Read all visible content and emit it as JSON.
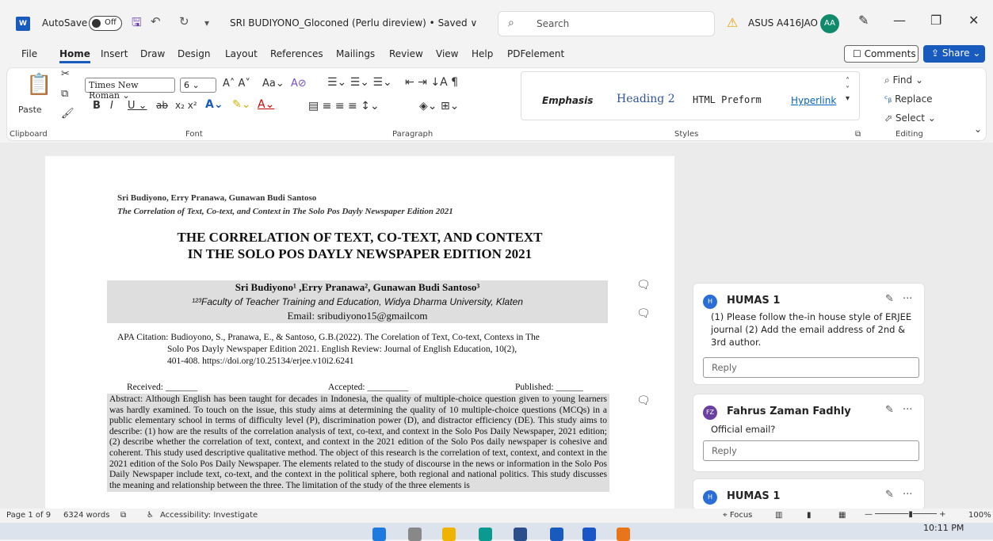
{
  "titlebar": {
    "app_icon": "W",
    "autosave_label": "AutoSave",
    "autosave_state": "Off",
    "doc_title": "SRI BUDIYONO_Gloconed (Perlu direview) • Saved ∨",
    "search_placeholder": "Search",
    "device": "ASUS A416JAO",
    "user_initials": "AA"
  },
  "menu": {
    "items": [
      "File",
      "Home",
      "Insert",
      "Draw",
      "Design",
      "Layout",
      "References",
      "Mailings",
      "Review",
      "View",
      "Help",
      "PDFelement"
    ],
    "comments_label": "Comments",
    "share_label": "Share"
  },
  "ribbon": {
    "paste_label": "Paste",
    "font_name": "Times New Roman",
    "font_size": "6",
    "groups": {
      "clipboard": "Clipboard",
      "font": "Font",
      "paragraph": "Paragraph",
      "styles": "Styles",
      "editing": "Editing"
    },
    "styles": [
      "Emphasis",
      "Heading 2",
      "HTML Preform",
      "Hyperlink"
    ],
    "editing": {
      "find": "Find",
      "replace": "Replace",
      "select": "Select"
    }
  },
  "document": {
    "header_authors": "Sri Budiyono, Erry Pranawa, Gunawan Budi Santoso",
    "header_title": "The Correlation of Text, Co-text, and Context in The Solo Pos Dayly Newspaper Edition 2021",
    "title_line1": "THE CORRELATION OF TEXT, CO-TEXT, AND CONTEXT",
    "title_line2": "IN THE SOLO POS DAYLY NEWSPAPER EDITION 2021",
    "authors": "Sri Budiyono¹ ,Erry Pranawa², Gunawan Budi Santoso³",
    "affiliation": "¹²³Faculty of Teacher Training and Education, Widya Dharma University, Klaten",
    "email": "Email: sribudiyono15@gmailcom",
    "apa_line1": "APA Citation: Budioyono, S., Pranawa, E., & Santoso, G.B.(2022). The Corelation of Text, Co-text, Contexs in The",
    "apa_line2": "Solo Pos Dayly Newspaper Edition 2021. English Review: Journal of English Education, 10(2),",
    "apa_line3": "401-408. https://doi.org/10.25134/erjee.v10i2.6241",
    "received": "Received: _______",
    "accepted": "Accepted: _________",
    "published": "Published: ______",
    "abstract": "Abstract: Although English has been taught for decades in Indonesia, the quality of multiple-choice question given to young learners was hardly examined. To touch on the issue, this study aims at determining the quality of 10 multiple-choice questions (MCQs) in a public elementary school in terms of difficulty level (P), discrimination power (D), and distractor efficiency (DE). This study aims to describe: (1) how are the results of the correlation analysis of text, co-text, and context in the Solo Pos Daily Newspaper, 2021 edition; (2) describe whether the correlation of text, context, and context in the 2021 edition of the Solo Pos daily newspaper is cohesive and coherent. This study used descriptive qualitative method. The object of this research is the correlation of text, context, and context in the 2021 edition of the Solo Pos Daily Newspaper. The elements related to the study of discourse in the news or information in the Solo Pos Daily Newspaper include text, co-text, and the context in the political sphere, both regional and national politics. This study discusses the meaning and relationship between the three. The limitation of the study of the three elements is"
  },
  "comments": [
    {
      "initials": "H",
      "author": "HUMAS 1",
      "text": "(1) Please follow the-in house style of ERJEE journal (2) Add the email address of 2nd & 3rd author.",
      "reply": "Reply",
      "color": "#2b6fd6"
    },
    {
      "initials": "FZ",
      "author": "Fahrus Zaman Fadhly",
      "text": "Official email?",
      "reply": "Reply",
      "color": "#6b3fa0"
    },
    {
      "initials": "H",
      "author": "HUMAS 1",
      "text": "",
      "reply": "",
      "color": "#2b6fd6"
    }
  ],
  "status": {
    "page": "Page 1 of 9",
    "words": "6324 words",
    "accessibility": "Accessibility: Investigate",
    "focus": "Focus",
    "zoom": "100%"
  },
  "taskbar": {
    "time": "10:11 PM"
  },
  "colors": {
    "accent": "#185abd",
    "highlight": "#dedede"
  }
}
